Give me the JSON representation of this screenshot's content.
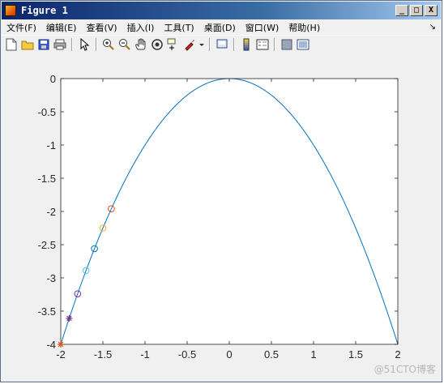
{
  "window": {
    "title": "Figure 1",
    "controls": {
      "minimize": "_",
      "maximize": "□",
      "close": "X"
    }
  },
  "menu": {
    "items": [
      "文件(F)",
      "编辑(E)",
      "查看(V)",
      "插入(I)",
      "工具(T)",
      "桌面(D)",
      "窗口(W)",
      "帮助(H)"
    ],
    "overflow": "↘"
  },
  "toolbar": {
    "icons": [
      "new-file-icon",
      "open-folder-icon",
      "save-icon",
      "print-icon",
      "pointer-icon",
      "zoom-in-icon",
      "zoom-out-icon",
      "pan-hand-icon",
      "rotate-3d-icon",
      "data-cursor-icon",
      "brush-icon",
      "print-preview-icon",
      "colorbar-icon",
      "legend-icon",
      "hide-plot-tools-icon",
      "show-plot-tools-icon"
    ]
  },
  "chart_data": {
    "type": "line",
    "title": "",
    "xlabel": "",
    "ylabel": "",
    "xlim": [
      -2,
      2
    ],
    "ylim": [
      -4,
      0
    ],
    "xticks": [
      "-2",
      "-1.5",
      "-1",
      "-0.5",
      "0",
      "0.5",
      "1",
      "1.5",
      "2"
    ],
    "yticks": [
      "0",
      "-0.5",
      "-1",
      "-1.5",
      "-2",
      "-2.5",
      "-3",
      "-3.5",
      "-4"
    ],
    "curve": {
      "function": "y = -x^2",
      "x_range": [
        -2,
        2
      ],
      "color": "#0072bd"
    },
    "markers": [
      {
        "x": -2.0,
        "y": -4.0,
        "marker": "star",
        "color": "#d95319"
      },
      {
        "x": -1.9,
        "y": -3.61,
        "marker": "star",
        "color": "#7e2f8e"
      },
      {
        "x": -1.8,
        "y": -3.24,
        "marker": "circle",
        "color": "#7e2f8e"
      },
      {
        "x": -1.7,
        "y": -2.89,
        "marker": "circle",
        "color": "#4dbeee"
      },
      {
        "x": -1.6,
        "y": -2.56,
        "marker": "circle",
        "color": "#0072bd"
      },
      {
        "x": -1.5,
        "y": -2.25,
        "marker": "circle",
        "color": "#edb120"
      },
      {
        "x": -1.4,
        "y": -1.96,
        "marker": "circle",
        "color": "#d95319"
      }
    ],
    "grid": false
  },
  "watermark": "@51CTO博客"
}
